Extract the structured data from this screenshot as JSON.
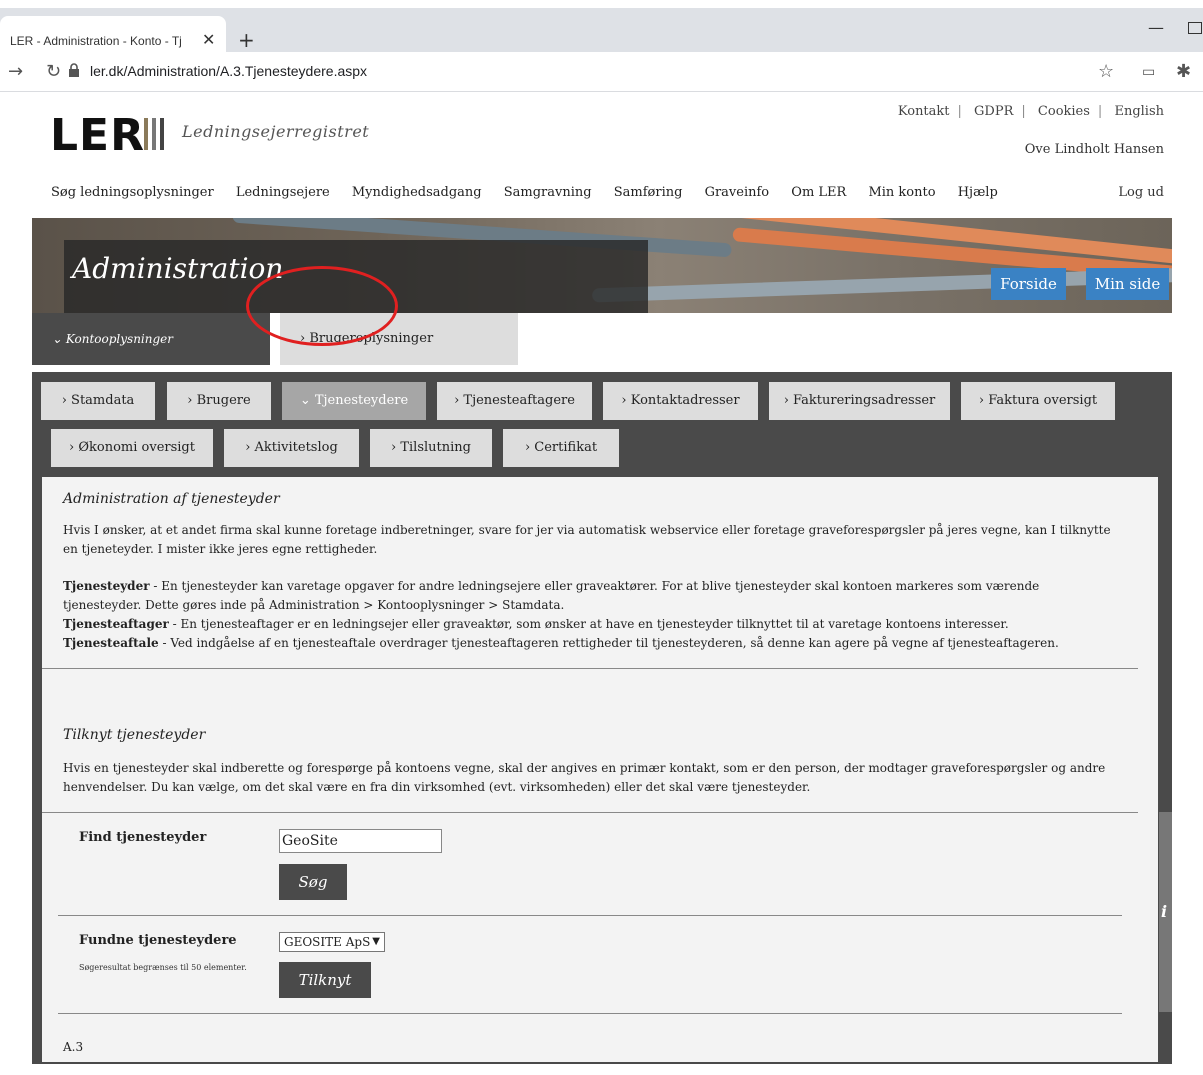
{
  "browser": {
    "tab_title": "LER - Administration - Konto - Tj",
    "tab_close": "✕",
    "new_tab": "+",
    "url": "ler.dk/Administration/A.3.Tjenesteydere.aspx",
    "icons": [
      "back-arrow-icon",
      "reload-icon",
      "lock-icon",
      "star-icon",
      "extension-icon",
      "puzzle-icon"
    ]
  },
  "header": {
    "logo": "LER",
    "logo_subtitle": "Ledningsejerregistret",
    "top_links": [
      "Kontakt",
      "GDPR",
      "Cookies",
      "English"
    ],
    "user_name": "Ove Lindholt Hansen",
    "nav": [
      "Søg ledningsoplysninger",
      "Ledningsejere",
      "Myndighedsadgang",
      "Samgravning",
      "Samføring",
      "Graveinfo",
      "Om LER",
      "Min konto",
      "Hjælp"
    ],
    "logout": "Log ud"
  },
  "banner": {
    "title": "Administration",
    "btn_forside": "Forside",
    "btn_minside": "Min side"
  },
  "subtabs": {
    "kontooplysninger": "⌄ Kontooplysninger",
    "brugeroplysninger": "› Brugeroplysninger"
  },
  "tabs": [
    "› Stamdata",
    "› Brugere",
    "⌄ Tjenesteydere",
    "› Tjenesteaftagere",
    "› Kontaktadresser",
    "› Faktureringsadresser",
    "› Faktura oversigt",
    "› Økonomi oversigt",
    "› Aktivitetslog",
    "› Tilslutning",
    "› Certifikat"
  ],
  "admin": {
    "heading": "Administration af tjenesteyder",
    "intro": "Hvis I ønsker, at et andet firma skal kunne foretage indberetninger, svare for jer via automatisk webservice eller foretage graveforespørgsler på jeres vegne, kan I tilknytte en tjeneteyder. I mister ikke jeres egne rettigheder.",
    "def1_term": "Tjenesteyder",
    "def1_text": " - En tjenesteyder kan varetage opgaver for andre ledningsejere eller graveaktører. For at blive tjenesteyder skal kontoen markeres som værende tjenesteyder. Dette gøres inde på Administration > Kontooplysninger > Stamdata.",
    "def2_term": "Tjenesteaftager",
    "def2_text": " - En tjenesteaftager er en ledningsejer eller graveaktør, som ønsker at have en tjenesteyder tilknyttet til at varetage kontoens interesser.",
    "def3_term": "Tjenesteaftale",
    "def3_text": " - Ved indgåelse af en tjenesteaftale overdrager tjenesteaftageren rettigheder til tjenesteyderen, så denne kan agere på vegne af tjenesteaftageren."
  },
  "attach": {
    "heading": "Tilknyt tjenesteyder",
    "text": "Hvis en tjenesteyder skal indberette og forespørge på kontoens vegne, skal der angives en primær kontakt, som er den person, der modtager graveforespørgsler og andre henvendelser. Du kan vælge, om det skal være en fra din virksomhed (evt. virksomheden) eller det skal være tjenesteyder.",
    "find_label": "Find tjenesteyder",
    "search_value": "GeoSite",
    "search_btn": "Søg",
    "found_label": "Fundne tjenesteydere",
    "found_note": "Søgeresultat begrænses til 50 elementer.",
    "select_value": "GEOSITE ApS",
    "attach_btn": "Tilknyt",
    "info": "i"
  },
  "footer_code": "A.3"
}
